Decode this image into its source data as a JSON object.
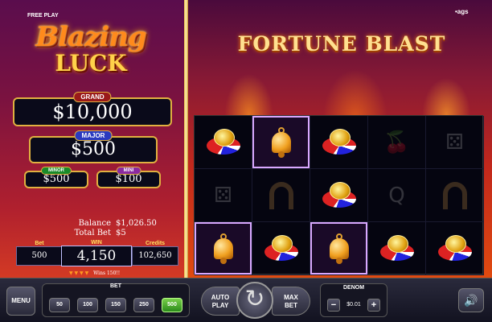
{
  "header": {
    "free_play": "FREE PLAY",
    "provider": "•ags"
  },
  "logo": {
    "line1": "Blazing",
    "line2": "LUCK"
  },
  "game_title": "FORTUNE BLAST",
  "jackpots": {
    "grand": {
      "label": "GRAND",
      "amount": "$10,000"
    },
    "major": {
      "label": "MAJOR",
      "amount": "$500"
    },
    "minor": {
      "label": "MINOR",
      "amount": "$500"
    },
    "mini": {
      "label": "MINI",
      "amount": "$100"
    }
  },
  "stats": {
    "balance_label": "Balance",
    "balance": "$1,026.50",
    "total_bet_label": "Total Bet",
    "total_bet": "$5"
  },
  "meters": {
    "bet_label": "Bet",
    "bet": "500",
    "win_label": "WIN",
    "win": "4,150",
    "credits_label": "Credits",
    "credits": "102,650"
  },
  "win_message": "Wins 150!!",
  "reels": [
    [
      "chips",
      "bell",
      "chips",
      "cherry",
      "dice"
    ],
    [
      "dice",
      "horseshoe",
      "chips",
      "Q",
      "horseshoe"
    ],
    [
      "bell",
      "chips",
      "bell",
      "chips",
      "chips"
    ]
  ],
  "highlighted": [
    [
      0,
      1
    ],
    [
      2,
      0
    ],
    [
      2,
      2
    ]
  ],
  "controls": {
    "menu": "MENU",
    "bet_label": "BET",
    "bet_options": [
      "50",
      "100",
      "150",
      "250",
      "500"
    ],
    "selected_bet": "500",
    "auto_play_1": "AUTO",
    "auto_play_2": "PLAY",
    "max_bet_1": "MAX",
    "max_bet_2": "BET",
    "denom_label": "DENOM",
    "denom_value": "$0.01",
    "minus": "−",
    "plus": "+"
  }
}
